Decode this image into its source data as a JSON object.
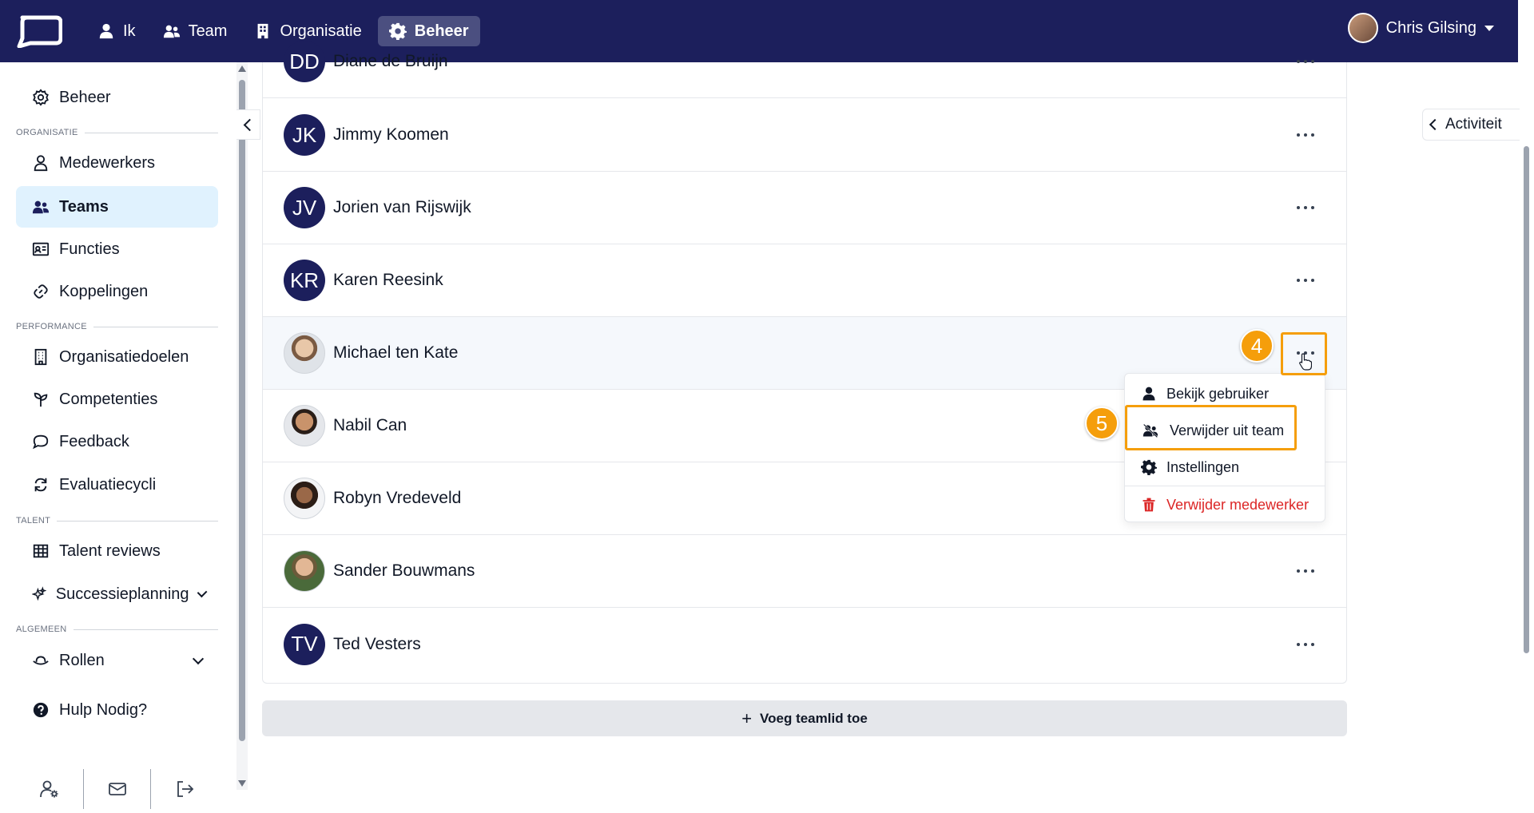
{
  "topbar": {
    "nav": [
      {
        "label": "Ik",
        "icon": "user-icon"
      },
      {
        "label": "Team",
        "icon": "users-icon"
      },
      {
        "label": "Organisatie",
        "icon": "building-icon"
      },
      {
        "label": "Beheer",
        "icon": "gear-icon",
        "active": true
      }
    ],
    "user_name": "Chris Gilsing"
  },
  "sidebar": {
    "beheer": "Beheer",
    "sections": {
      "organisatie": "ORGANISATIE",
      "performance": "PERFORMANCE",
      "talent": "TALENT",
      "algemeen": "ALGEMEEN"
    },
    "items": {
      "medewerkers": "Medewerkers",
      "teams": "Teams",
      "functies": "Functies",
      "koppelingen": "Koppelingen",
      "organisatiedoelen": "Organisatiedoelen",
      "competenties": "Competenties",
      "feedback": "Feedback",
      "evaluatiecycli": "Evaluatiecycli",
      "talent_reviews": "Talent reviews",
      "successieplanning": "Successieplanning",
      "rollen": "Rollen",
      "hulp": "Hulp Nodig?"
    }
  },
  "members": [
    {
      "initials": "DD",
      "name": "Diane de Bruijn"
    },
    {
      "initials": "JK",
      "name": "Jimmy Koomen"
    },
    {
      "initials": "JV",
      "name": "Jorien van Rijswijk"
    },
    {
      "initials": "KR",
      "name": "Karen Reesink"
    },
    {
      "initials": "",
      "name": "Michael ten Kate"
    },
    {
      "initials": "",
      "name": "Nabil Can"
    },
    {
      "initials": "",
      "name": "Robyn Vredeveld"
    },
    {
      "initials": "",
      "name": "Sander Bouwmans"
    },
    {
      "initials": "TV",
      "name": "Ted Vesters"
    }
  ],
  "add_member_label": "Voeg teamlid toe",
  "activity_label": "Activiteit",
  "context_menu": {
    "view_user": "Bekijk gebruiker",
    "remove_from_team": "Verwijder uit team",
    "settings": "Instellingen",
    "delete_employee": "Verwijder medewerker"
  },
  "steps": {
    "step4": "4",
    "step5": "5"
  },
  "colors": {
    "brand": "#1c1f5c",
    "highlight": "#f59e0b",
    "danger": "#dc2626",
    "active_bg": "#e0f2fe"
  }
}
